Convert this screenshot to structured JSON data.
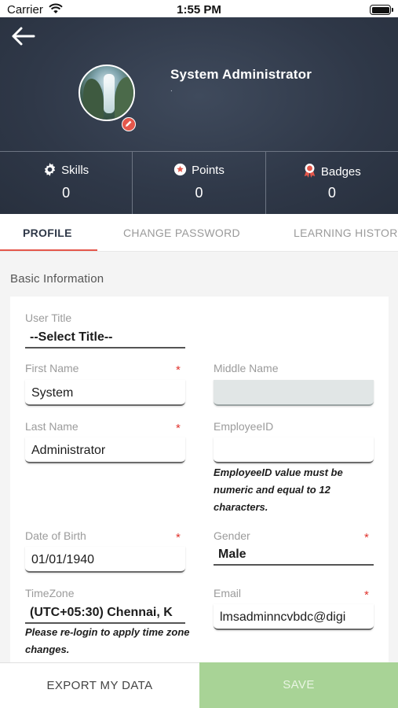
{
  "status_bar": {
    "carrier": "Carrier",
    "time": "1:55 PM"
  },
  "header": {
    "user_name": "System Administrator",
    "user_subtitle": ".",
    "stats": [
      {
        "label": "Skills",
        "value": "0",
        "icon": "gear-icon"
      },
      {
        "label": "Points",
        "value": "0",
        "icon": "star-badge-icon"
      },
      {
        "label": "Badges",
        "value": "0",
        "icon": "ribbon-icon"
      }
    ]
  },
  "tabs": [
    {
      "label": "PROFILE",
      "active": true
    },
    {
      "label": "CHANGE PASSWORD",
      "active": false
    },
    {
      "label": "LEARNING HISTORY",
      "active": false
    }
  ],
  "section_title": "Basic Information",
  "form": {
    "user_title": {
      "label": "User Title",
      "value": "--Select Title--"
    },
    "first_name": {
      "label": "First Name",
      "value": "System",
      "required": "*"
    },
    "middle_name": {
      "label": "Middle Name",
      "value": ""
    },
    "last_name": {
      "label": "Last Name",
      "value": "Administrator",
      "required": "*"
    },
    "employee_id": {
      "label": "EmployeeID",
      "value": "",
      "hint": "EmployeeID value must be numeric and equal to 12 characters."
    },
    "date_of_birth": {
      "label": "Date of Birth",
      "value": "01/01/1940",
      "required": "*"
    },
    "gender": {
      "label": "Gender",
      "value": "Male",
      "required": "*"
    },
    "timezone": {
      "label": "TimeZone",
      "value": "(UTC+05:30) Chennai, K",
      "hint": "Please re-login to apply time zone changes."
    },
    "email": {
      "label": "Email",
      "value": "lmsadminncvbdc@digi",
      "required": "*"
    }
  },
  "bottom_bar": {
    "export_label": "EXPORT MY DATA",
    "save_label": "SAVE"
  },
  "colors": {
    "header": "#2f3848",
    "accent": "#e4574b",
    "save": "#a8d396"
  }
}
